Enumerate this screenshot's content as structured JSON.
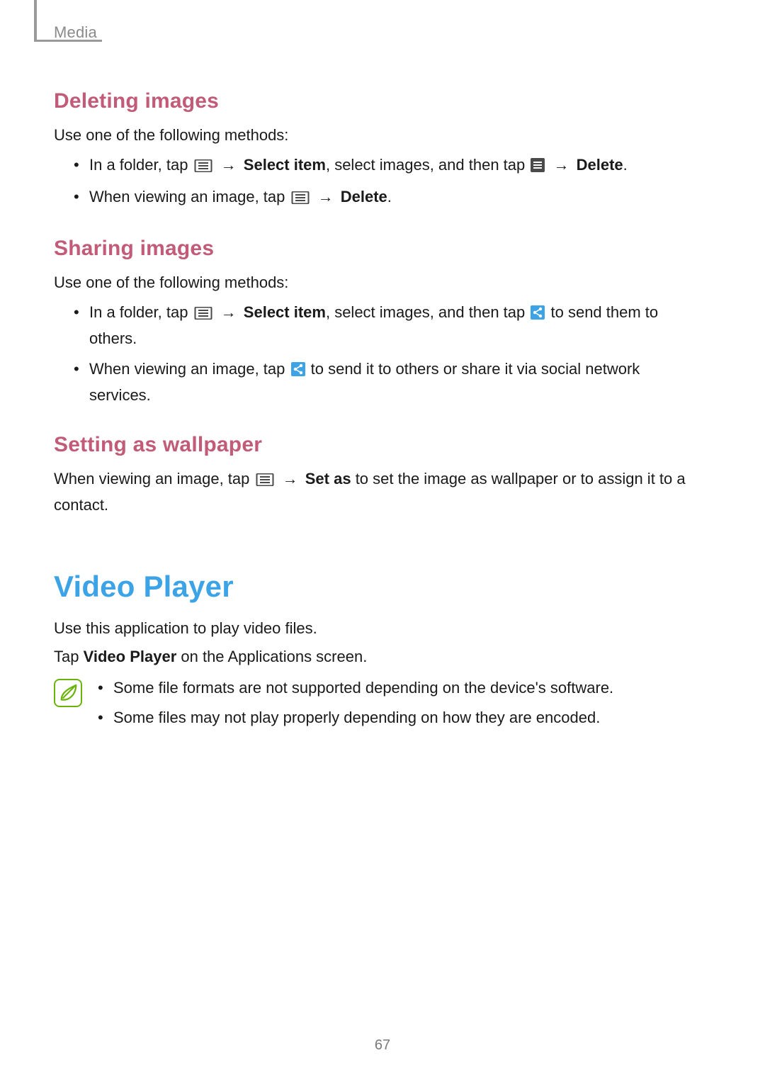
{
  "breadcrumb": "Media",
  "section_deleting": {
    "heading": "Deleting images",
    "intro": "Use one of the following methods:",
    "bullets": [
      {
        "pre": "In a folder, tap ",
        "icon1": "menu-outline",
        "arrow1": " → ",
        "bold1": "Select item",
        "mid": ", select images, and then tap ",
        "icon2": "menu-filled",
        "arrow2": " → ",
        "bold2": "Delete",
        "post": "."
      },
      {
        "pre": "When viewing an image, tap ",
        "icon1": "menu-outline",
        "arrow1": " → ",
        "bold1": "Delete",
        "post": "."
      }
    ]
  },
  "section_sharing": {
    "heading": "Sharing images",
    "intro": "Use one of the following methods:",
    "bullets": [
      {
        "pre": "In a folder, tap ",
        "icon1": "menu-outline",
        "arrow1": " → ",
        "bold1": "Select item",
        "mid": ", select images, and then tap ",
        "icon2": "share",
        "post": " to send them to others."
      },
      {
        "pre": "When viewing an image, tap ",
        "icon1": "share",
        "post": " to send it to others or share it via social network services."
      }
    ]
  },
  "section_wallpaper": {
    "heading": "Setting as wallpaper",
    "para_pre": "When viewing an image, tap ",
    "para_icon": "menu-outline",
    "para_arrow": " → ",
    "para_bold": "Set as",
    "para_post": " to set the image as wallpaper or to assign it to a contact."
  },
  "section_video": {
    "heading": "Video Player",
    "p1": "Use this application to play video files.",
    "p2_pre": "Tap ",
    "p2_bold": "Video Player",
    "p2_post": " on the Applications screen.",
    "note_icon": "leaf-note",
    "notes": [
      "Some file formats are not supported depending on the device's software.",
      "Some files may not play properly depending on how they are encoded."
    ]
  },
  "page_number": "67"
}
